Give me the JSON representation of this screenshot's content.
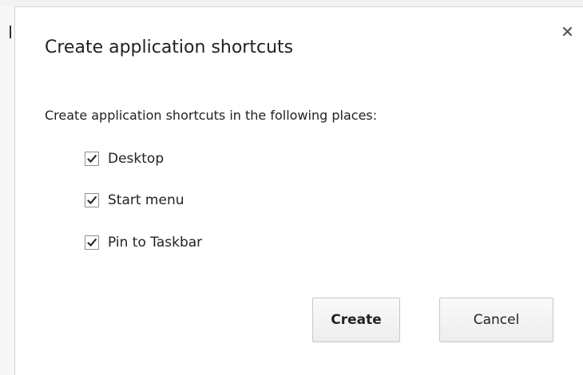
{
  "dialog": {
    "title": "Create application shortcuts",
    "close_icon": "close-icon",
    "description": "Create application shortcuts in the following places:",
    "options": [
      {
        "label": "Desktop",
        "checked": true
      },
      {
        "label": "Start menu",
        "checked": true
      },
      {
        "label": "Pin to Taskbar",
        "checked": true
      }
    ],
    "buttons": {
      "create_label": "Create",
      "cancel_label": "Cancel"
    }
  },
  "colors": {
    "text": "#222222",
    "checkbox_border": "#8f8f8f",
    "button_border": "#c6c6c6"
  }
}
